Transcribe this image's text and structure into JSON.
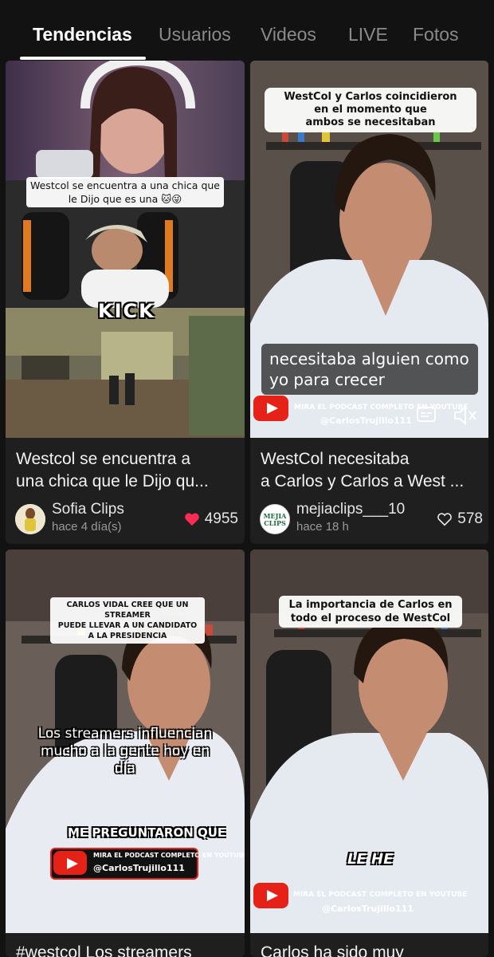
{
  "tabs": [
    {
      "label": "Tendencias",
      "active": true
    },
    {
      "label": "Usuarios",
      "active": false
    },
    {
      "label": "Videos",
      "active": false
    },
    {
      "label": "LIVE",
      "active": false
    },
    {
      "label": "Fotos",
      "active": false
    }
  ],
  "cards": [
    {
      "title_line1": "Westcol se encuentra a",
      "title_line2": "una chica que le Dijo qu...",
      "overlay_caption": "Westcol se encuentra a una chica que le Dijo que es una 🐱😜",
      "overlay_brand": "KICK",
      "author": "Sofia Clips",
      "time_ago": "hace 4 día(s)",
      "likes": "4955",
      "liked": true
    },
    {
      "title_line1": "WestCol necesitaba",
      "title_line2": "a Carlos y Carlos a West ...",
      "overlay_caption_line1": "WestCol y Carlos coincidieron",
      "overlay_caption_line2": "en el momento que",
      "overlay_caption_line3": "ambos se necesitaban",
      "subtitle_line1": "necesitaba alguien como",
      "subtitle_line2": "yo para crecer",
      "promo_line1": "MIRA EL PODCAST COMPLETO EN YOUTUBE",
      "promo_line2": "@CarlosTrujillo111",
      "author": "mejiaclips___10",
      "avatar_text": "MEJIA CLIPS",
      "time_ago": "hace 18 h",
      "likes": "578",
      "liked": false
    },
    {
      "title_partial": "#westcol Los streamers",
      "overlay_caption_line1": "CARLOS VIDAL CREE QUE UN STREAMER",
      "overlay_caption_line2": "PUEDE LLEVAR A UN CANDIDATO",
      "overlay_caption_line3": "A LA PRESIDENCIA",
      "subtitle_line1": "Los streamers influencian",
      "subtitle_line2": "mucho a la gente hoy en día",
      "subtitle_line3": "ME PREGUNTARON QUE",
      "promo_line1": "MIRA EL PODCAST COMPLETO EN YOUTUBE",
      "promo_line2": "@CarlosTrujillo111"
    },
    {
      "title_partial": "Carlos ha sido muy",
      "overlay_caption_line1": "La importancia de Carlos en",
      "overlay_caption_line2": "todo el proceso de WestCol",
      "subtitle_line1": "LE HE",
      "promo_line1": "MIRA EL PODCAST COMPLETO EN YOUTUBE",
      "promo_line2": "@CarlosTrujillo111"
    }
  ],
  "colors": {
    "background": "#121212",
    "card": "#1f1f1f",
    "like_active": "#fe2c55",
    "tab_inactive": "#8a8a8a"
  },
  "icons": {
    "like": "heart-icon",
    "youtube": "youtube-icon",
    "mute": "speaker-mute-icon",
    "captions": "captions-icon"
  }
}
